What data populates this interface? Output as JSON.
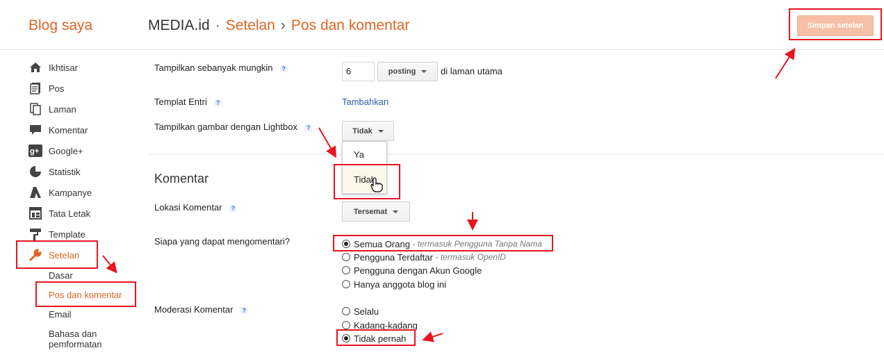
{
  "header": {
    "blog_title": "Blog saya",
    "crumb_site": "MEDIA.id",
    "crumb_sep1": "·",
    "crumb_settings": "Setelan",
    "crumb_sep2": "›",
    "crumb_page": "Pos dan komentar",
    "save_label": "Simpan setelan"
  },
  "sidebar": {
    "items": [
      {
        "label": "Ikhtisar",
        "icon": "home-icon"
      },
      {
        "label": "Pos",
        "icon": "posts-icon"
      },
      {
        "label": "Laman",
        "icon": "pages-icon"
      },
      {
        "label": "Komentar",
        "icon": "comment-icon"
      },
      {
        "label": "Google+",
        "icon": "googleplus-icon"
      },
      {
        "label": "Statistik",
        "icon": "stats-icon"
      },
      {
        "label": "Kampanye",
        "icon": "campaign-icon"
      },
      {
        "label": "Tata Letak",
        "icon": "layout-icon"
      },
      {
        "label": "Template",
        "icon": "template-icon"
      },
      {
        "label": "Setelan",
        "icon": "wrench-icon"
      }
    ],
    "sub_items": [
      "Dasar",
      "Pos dan komentar",
      "Email",
      "Bahasa dan",
      "pemformatan"
    ]
  },
  "posts": {
    "show_label": "Tampilkan sebanyak mungkin",
    "show_value": "6",
    "show_unit": "posting",
    "show_suffix": "di laman utama",
    "template_label": "Templat Entri",
    "template_link": "Tambahkan",
    "lightbox_label": "Tampilkan gambar dengan Lightbox",
    "lightbox_value": "Tidak",
    "lightbox_options": [
      "Ya",
      "Tidak"
    ],
    "help": "?"
  },
  "comments": {
    "section_title": "Komentar",
    "location_label": "Lokasi Komentar",
    "location_value": "Tersemat",
    "who_label": "Siapa yang dapat mengomentari?",
    "who_options": [
      {
        "label": "Semua Orang",
        "hint": "- termasuk Pengguna Tanpa Nama"
      },
      {
        "label": "Pengguna Terdaftar",
        "hint": "- termasuk OpenID"
      },
      {
        "label": "Pengguna dengan Akun Google",
        "hint": ""
      },
      {
        "label": "Hanya anggota blog ini",
        "hint": ""
      }
    ],
    "moderation_label": "Moderasi Komentar",
    "moderation_options": [
      "Selalu",
      "Kadang-kadang",
      "Tidak pernah"
    ]
  },
  "colors": {
    "accent": "#dd6622",
    "annotation": "#e8141f",
    "link": "#2a5db0"
  }
}
